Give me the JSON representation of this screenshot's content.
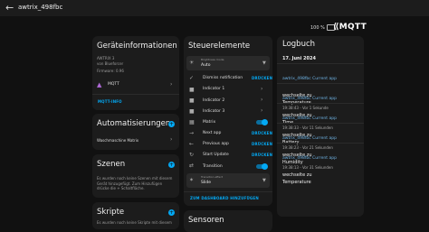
{
  "window": {
    "title": "awtrix_498fbc",
    "battery": "100 %"
  },
  "brand": {
    "logo": "MQTT"
  },
  "device_info": {
    "title": "Geräteinformationen",
    "model": "AWTRIX 3",
    "vendor": "von Blueforcer",
    "firmware": "Firmware: 0.96",
    "integration": "MQTT",
    "button": "MQTT-INFO"
  },
  "automations": {
    "title": "Automatisierungen",
    "item": "Waschmaschine Matrix"
  },
  "scenes": {
    "title": "Szenen",
    "desc": "Es wurden noch keine Szenen mit diesem Gerät hinzugefügt. Zum Hinzufügen drücke die + Schaltfläche."
  },
  "scripts": {
    "title": "Skripte",
    "desc": "Es wurden noch keine Skripte mit diesem"
  },
  "controls": {
    "title": "Steuerelemente",
    "brightness_label": "Brightness mode",
    "brightness_value": "Auto",
    "items": [
      {
        "label": "Dismiss notification",
        "action": "DRÜCKEN"
      },
      {
        "label": "Indicator 1"
      },
      {
        "label": "Indicator 2"
      },
      {
        "label": "Indicator 3"
      },
      {
        "label": "Matrix"
      },
      {
        "label": "Next app",
        "action": "DRÜCKEN"
      },
      {
        "label": "Previous app",
        "action": "DRÜCKEN"
      },
      {
        "label": "Start Update",
        "action": "DRÜCKEN"
      },
      {
        "label": "Transition"
      }
    ],
    "effect_label": "Transition effect",
    "effect_value": "Slide",
    "dashboard_button": "ZUM DASHBOARD HINZUFÜGEN"
  },
  "sensors": {
    "title": "Sensoren"
  },
  "logbook": {
    "title": "Logbuch",
    "date": "17. Juni 2024",
    "entries": [
      {
        "link": "awtrix_498fbc Current app",
        "text": "wechselte zu",
        "name": "Temperature",
        "time": "19:38:43 - Vor 1 Sekunde"
      },
      {
        "link": "awtrix_498fbc Current app",
        "text": "wechselte zu",
        "name": "Time",
        "time": "19:38:33 - Vor 11 Sekunden"
      },
      {
        "link": "awtrix_498fbc Current app",
        "text": "wechselte zu",
        "name": "Battery",
        "time": "19:38:23 - Vor 21 Sekunden"
      },
      {
        "link": "awtrix_498fbc Current app",
        "text": "wechselte zu",
        "name": "Humidity",
        "time": "19:38:13 - Vor 31 Sekunden"
      },
      {
        "link": "awtrix_498fbc Current app",
        "text": "wechselte zu",
        "name": "Temperature",
        "time": ""
      }
    ]
  }
}
